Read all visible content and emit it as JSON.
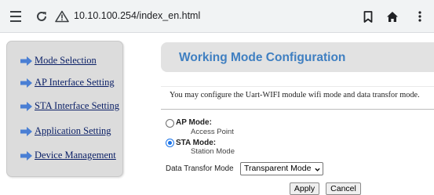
{
  "browser": {
    "url": "10.10.100.254/index_en.html",
    "icons": [
      "menu-icon",
      "reload-icon",
      "warning-icon",
      "bookmark-icon",
      "home-icon",
      "more-icon"
    ]
  },
  "sidebar": {
    "items": [
      {
        "label": "Mode Selection"
      },
      {
        "label": "AP Interface Setting"
      },
      {
        "label": "STA Interface Setting"
      },
      {
        "label": "Application Setting"
      },
      {
        "label": "Device Management"
      }
    ],
    "arrow_color": "#4a7fd4"
  },
  "main": {
    "title": "Working Mode Configuration",
    "description": "You may configure the Uart-WIFI module wifi mode and data transfor mode.",
    "options": [
      {
        "label": "AP Mode:",
        "sub": "Access Point",
        "checked": false
      },
      {
        "label": "STA Mode:",
        "sub": "Station Mode",
        "checked": true
      }
    ],
    "data_mode_label": "Data Transfor Mode",
    "data_mode_value": "Transparent Mode",
    "apply_label": "Apply",
    "cancel_label": "Cancel"
  },
  "colors": {
    "title": "#3f7fc1",
    "link": "#0a1f66",
    "radio_checked": "#1a73e8"
  }
}
